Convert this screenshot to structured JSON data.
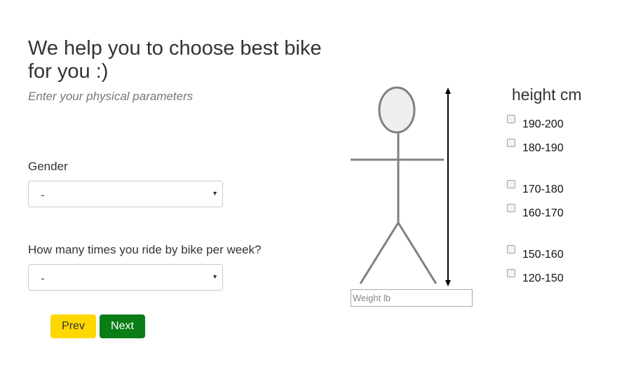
{
  "header": {
    "title": "We help you to choose best bike for you :)",
    "subtitle": "Enter your physical parameters"
  },
  "form": {
    "gender": {
      "label": "Gender",
      "value": "-"
    },
    "rides": {
      "label": "How many times you ride by bike per week?",
      "value": "-"
    },
    "weight": {
      "placeholder": "Weight lb"
    }
  },
  "buttons": {
    "prev_label": "Prev",
    "next_label": "Next"
  },
  "height": {
    "title": "height cm",
    "options": [
      "190-200",
      "180-190",
      "170-180",
      "160-170",
      "150-160",
      "120-150"
    ]
  },
  "colors": {
    "prev_button": "#ffd700",
    "next_button": "#0a7d16",
    "figure_stroke": "#808080",
    "head_fill": "#efefef"
  },
  "icons": {
    "select_caret": "▼"
  }
}
